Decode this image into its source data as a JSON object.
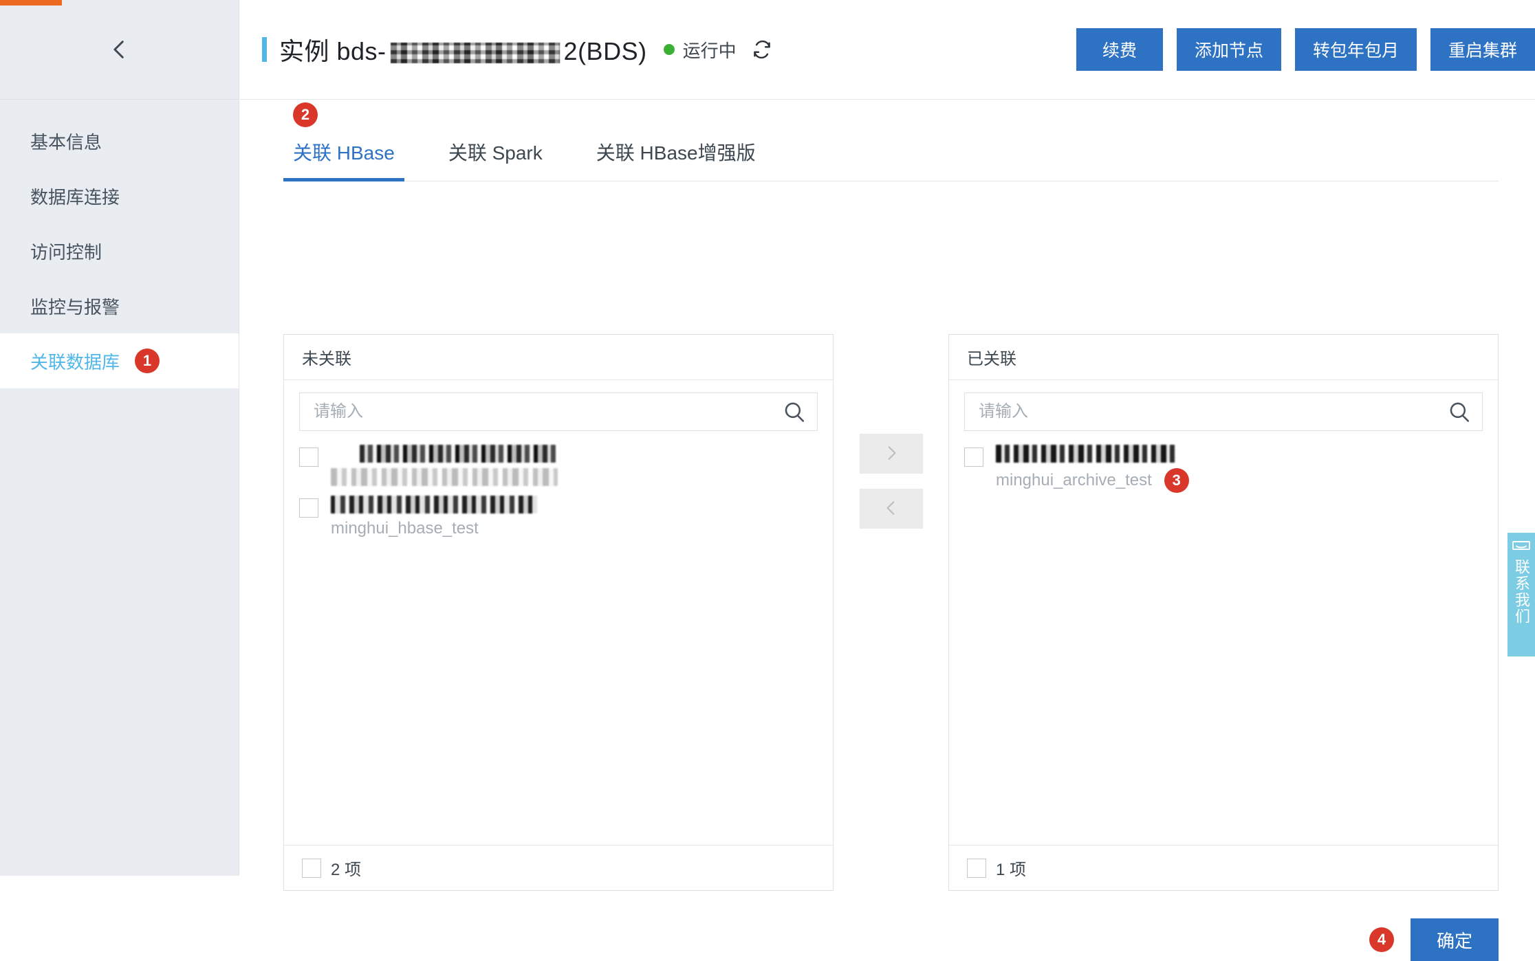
{
  "progress": {
    "percent": 4
  },
  "sidebar": {
    "back_icon": "chevron-left-icon",
    "items": [
      {
        "label": "基本信息",
        "active": false
      },
      {
        "label": "数据库连接",
        "active": false
      },
      {
        "label": "访问控制",
        "active": false
      },
      {
        "label": "监控与报警",
        "active": false
      },
      {
        "label": "关联数据库",
        "active": true,
        "badge": "1"
      }
    ]
  },
  "header": {
    "title_prefix": "实例 bds-",
    "title_suffix": "2(BDS)",
    "status": "运行中",
    "status_color": "#3cb034",
    "refresh_icon": "refresh-icon",
    "buttons": [
      {
        "label": "续费"
      },
      {
        "label": "添加节点"
      },
      {
        "label": "转包年包月"
      },
      {
        "label": "重启集群"
      }
    ]
  },
  "tabs": [
    {
      "label": "关联 HBase",
      "active": true,
      "badge": "2"
    },
    {
      "label": "关联 Spark",
      "active": false
    },
    {
      "label": "关联 HBase增强版",
      "active": false
    }
  ],
  "transfer": {
    "left": {
      "title": "未关联",
      "search_placeholder": "请输入",
      "search_value": "",
      "search_icon": "search-icon",
      "items": [
        {
          "name_redacted": true,
          "sub_redacted": true,
          "sub": "",
          "checked": false
        },
        {
          "name_redacted": true,
          "sub_redacted": false,
          "sub": "minghui_hbase_test",
          "checked": false
        }
      ],
      "footer_count": "2 项",
      "footer_checked": false
    },
    "right": {
      "title": "已关联",
      "search_placeholder": "请输入",
      "search_value": "",
      "search_icon": "search-icon",
      "items": [
        {
          "name_redacted": true,
          "sub_redacted": false,
          "sub": "minghui_archive_test",
          "badge": "3",
          "checked": false
        }
      ],
      "footer_count": "1 项",
      "footer_checked": false
    },
    "to_right_icon": "chevron-right-icon",
    "to_left_icon": "chevron-left-icon"
  },
  "footer": {
    "confirm_label": "确定",
    "confirm_badge": "4"
  },
  "contact_widget": {
    "label": "联系我们",
    "icon": "chat-bubble-icon",
    "color": "#7ccde4"
  },
  "colors": {
    "primary": "#2e72c4",
    "accent": "#51b6e8",
    "badge_red": "#d9372a",
    "progress_orange": "#ec6a20",
    "sidebar_bg": "#e9edf1"
  }
}
